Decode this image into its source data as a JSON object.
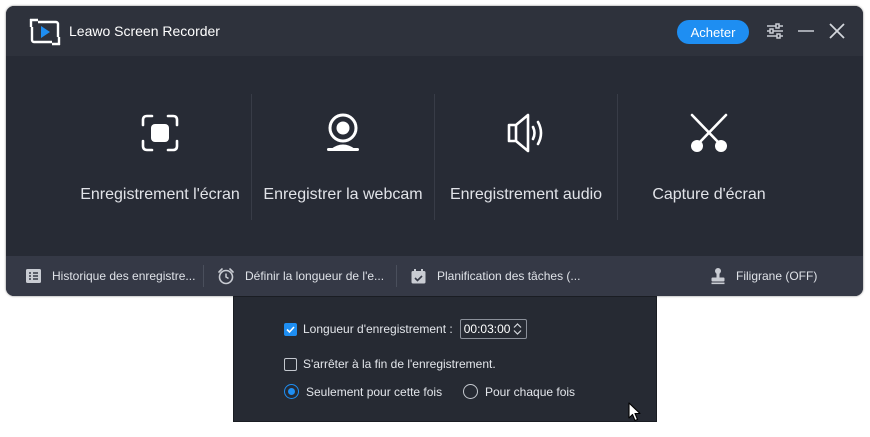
{
  "app": {
    "title": "Leawo Screen Recorder",
    "buy_label": "Acheter"
  },
  "colors": {
    "accent": "#1e8ef2",
    "window_bg": "#272b35",
    "statusbar_bg": "#353946"
  },
  "modes": [
    {
      "label": "Enregistrement l'écran",
      "icon": "screen-record-icon"
    },
    {
      "label": "Enregistrer la webcam",
      "icon": "webcam-icon"
    },
    {
      "label": "Enregistrement audio",
      "icon": "speaker-icon"
    },
    {
      "label": "Capture d'écran",
      "icon": "scissors-icon"
    }
  ],
  "statusbar": {
    "history": "Historique des enregistre...",
    "duration": "Définir la longueur de l'e...",
    "schedule": "Planification des tâches (...",
    "watermark": "Filigrane (OFF)"
  },
  "popup": {
    "length_label": "Longueur d'enregistrement :",
    "length_checked": true,
    "length_value": "00:03:00",
    "stop_label": "S'arrêter à la fin de l'enregistrement.",
    "stop_checked": false,
    "once_label": "Seulement pour cette fois",
    "every_label": "Pour chaque fois",
    "selected": "once"
  }
}
